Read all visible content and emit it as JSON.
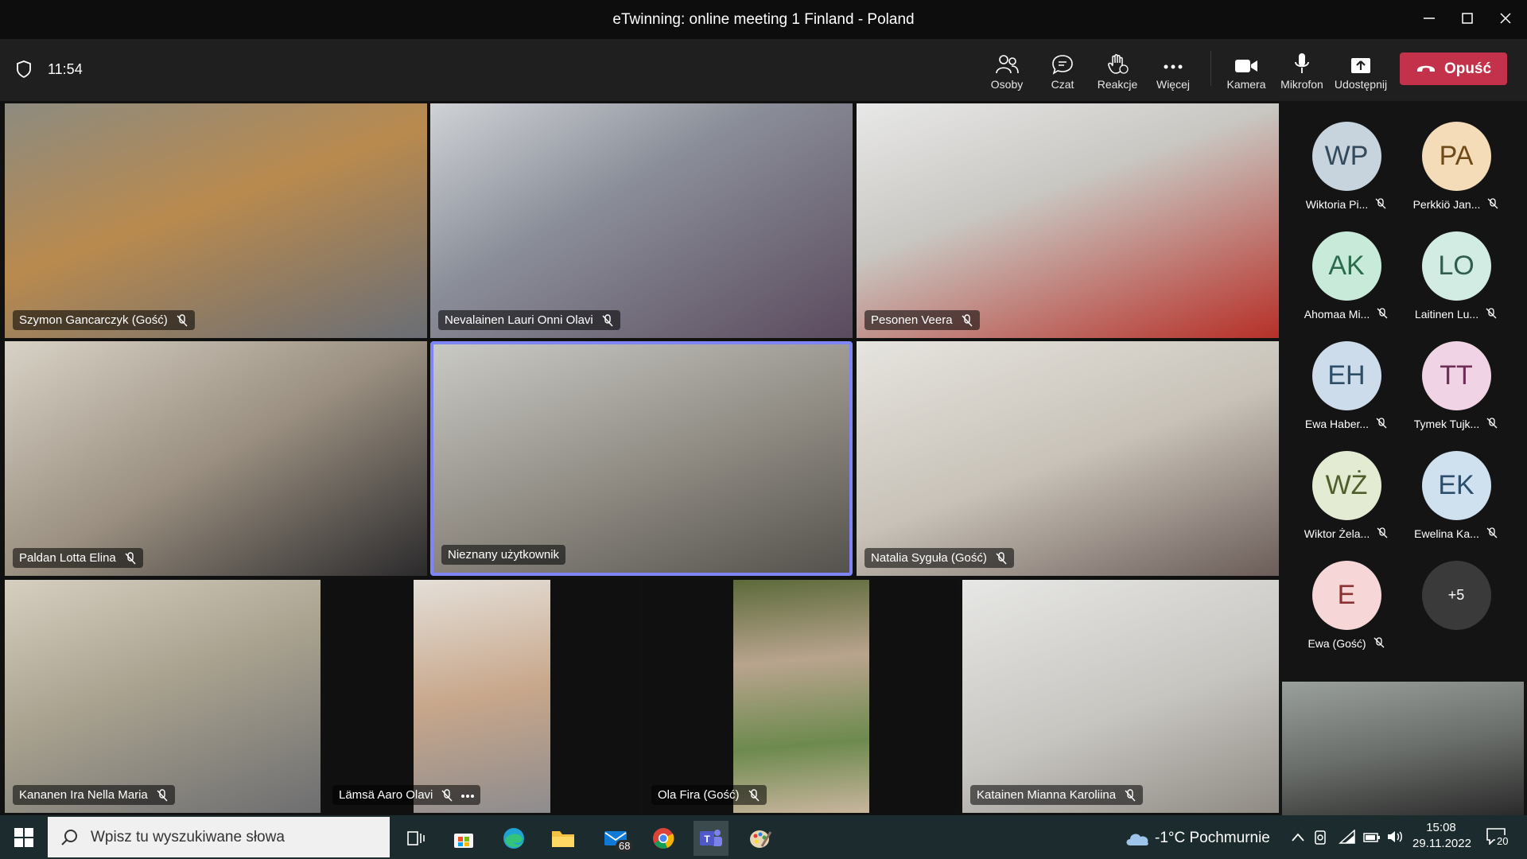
{
  "window": {
    "title": "eTwinning: online meeting 1 Finland - Poland"
  },
  "meeting": {
    "time": "11:54",
    "controls": {
      "people": "Osoby",
      "chat": "Czat",
      "reactions": "Reakcje",
      "more": "Więcej",
      "camera": "Kamera",
      "mic": "Mikrofon",
      "share": "Udostępnij",
      "leave": "Opuść"
    }
  },
  "participants": [
    {
      "name": "Szymon Gancarczyk (Gość)"
    },
    {
      "name": "Nevalainen Lauri Onni Olavi"
    },
    {
      "name": "Pesonen Veera"
    },
    {
      "name": "Paldan Lotta Elina"
    },
    {
      "name": "Nieznany użytkownik"
    },
    {
      "name": "Natalia Syguła (Gość)"
    },
    {
      "name": "Kananen Ira Nella Maria"
    },
    {
      "name": "Lämsä Aaro Olavi"
    },
    {
      "name": "Ola Fira (Gość)"
    },
    {
      "name": "Katainen Mianna Karoliina"
    }
  ],
  "roster": [
    {
      "initials": "WP",
      "name": "Wiktoria Pi...",
      "bg": "#c7d4de",
      "fg": "#334a5c"
    },
    {
      "initials": "PA",
      "name": "Perkkiö Jan...",
      "bg": "#f3dcb7",
      "fg": "#6e4a18"
    },
    {
      "initials": "AK",
      "name": "Ahomaa Mi...",
      "bg": "#c8ead9",
      "fg": "#2b6b4c"
    },
    {
      "initials": "LO",
      "name": "Laitinen Lu...",
      "bg": "#d3ece3",
      "fg": "#2f5e4c"
    },
    {
      "initials": "EH",
      "name": "Ewa Haber...",
      "bg": "#cddcea",
      "fg": "#2e4d66"
    },
    {
      "initials": "TT",
      "name": "Tymek Tujk...",
      "bg": "#f0d3e4",
      "fg": "#6d2f55"
    },
    {
      "initials": "WŻ",
      "name": "Wiktor Żela...",
      "bg": "#e3ecd3",
      "fg": "#4f5f2c"
    },
    {
      "initials": "EK",
      "name": "Ewelina Ka...",
      "bg": "#cfe0ef",
      "fg": "#2c4d6b"
    },
    {
      "initials": "E",
      "name": "Ewa (Gość)",
      "bg": "#f6d6d6",
      "fg": "#8a3131"
    },
    {
      "initials": "+5",
      "name": "",
      "bg": "#3a3a3a",
      "fg": "#ffffff"
    }
  ],
  "taskbar": {
    "search_placeholder": "Wpisz tu wyszukiwane słowa",
    "mail_badge": "68",
    "weather": "-1°C  Pochmurnie",
    "time": "15:08",
    "date": "29.11.2022",
    "notifications": "20"
  },
  "colors": {
    "accent": "#c4314b",
    "active_speaker": "#7f85f5"
  }
}
